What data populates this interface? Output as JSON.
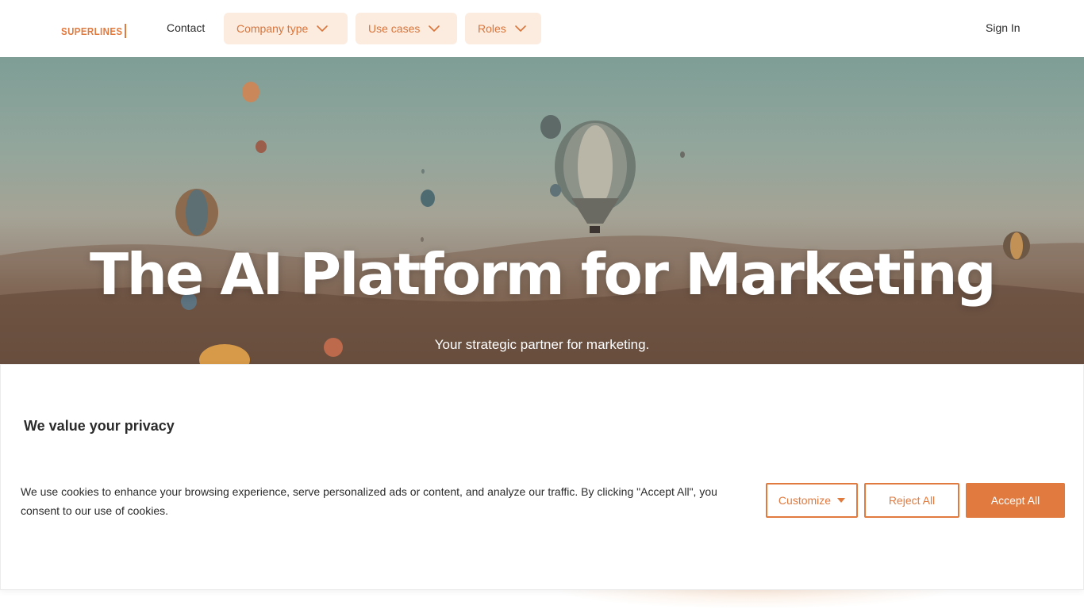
{
  "nav": {
    "logo_text": "SUPERLINES",
    "contact_label": "Contact",
    "dropdowns": [
      {
        "label": "Company type"
      },
      {
        "label": "Use cases"
      },
      {
        "label": "Roles"
      }
    ],
    "signin_label": "Sign In"
  },
  "hero": {
    "title": "The AI Platform for Marketing",
    "subtitle": "Your strategic partner for marketing."
  },
  "cookie_banner": {
    "title": "We value your privacy",
    "text": "We use cookies to enhance your browsing experience, serve personalized ads or content, and analyze our traffic. By clicking \"Accept All\", you consent to our use of cookies.",
    "customize_label": "Customize",
    "reject_label": "Reject All",
    "accept_label": "Accept All"
  },
  "colors": {
    "brand_orange": "#e07a3f",
    "dropdown_bg": "#fcecdf",
    "text_dark": "#2b2b2b"
  },
  "icons": {
    "dropdown": "chevron-down-icon",
    "customize_caret": "caret-down-icon"
  }
}
